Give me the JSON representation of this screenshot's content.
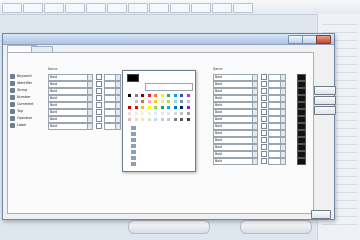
{
  "toolbar": {
    "items": [
      "",
      "",
      "",
      "",
      "",
      "",
      "",
      "",
      "",
      "",
      "",
      ""
    ]
  },
  "dialog": {
    "title": "",
    "tabs": [
      "",
      ""
    ],
    "group_label": "",
    "left_columns": {
      "name": "Name",
      "type": "",
      "back_color": "",
      "fore_color": ""
    },
    "left_rows": [
      {
        "label": "Keyword",
        "style": "Bold",
        "checked": false,
        "color": "#000000"
      },
      {
        "label": "Identifier",
        "style": "Bold",
        "checked": false,
        "color": "#000000"
      },
      {
        "label": "String",
        "style": "Bold",
        "checked": false,
        "color": "#000000"
      },
      {
        "label": "Number",
        "style": "Bold",
        "checked": false,
        "color": "#000000"
      },
      {
        "label": "Comment",
        "style": "Bold",
        "checked": false,
        "color": "#000000"
      },
      {
        "label": "Tag",
        "style": "Bold",
        "checked": false,
        "color": "#000000"
      },
      {
        "label": "Operator",
        "style": "Bold",
        "checked": false,
        "color": "#000000"
      },
      {
        "label": "Label",
        "style": "Bold",
        "checked": false,
        "color": "#000000"
      }
    ],
    "right_columns": {
      "name": "Name",
      "type": "",
      "fore_color": ""
    },
    "right_rows": [
      {
        "style": "Bold",
        "color": "#111111"
      },
      {
        "style": "Bold",
        "color": "#111111"
      },
      {
        "style": "Bold",
        "color": "#111111"
      },
      {
        "style": "Bold",
        "color": "#111111"
      },
      {
        "style": "Bold",
        "color": "#111111"
      },
      {
        "style": "Bold",
        "color": "#111111"
      },
      {
        "style": "Bold",
        "color": "#111111"
      },
      {
        "style": "Bold",
        "color": "#111111"
      },
      {
        "style": "Bold",
        "color": "#111111"
      },
      {
        "style": "Bold",
        "color": "#111111"
      },
      {
        "style": "Bold",
        "color": "#111111"
      },
      {
        "style": "Bold",
        "color": "#111111"
      },
      {
        "style": "Bold",
        "color": "#111111"
      }
    ],
    "buttons": [
      "",
      "",
      ""
    ],
    "popup": {
      "header": "",
      "options": [
        "",
        "",
        "",
        "",
        "",
        "",
        ""
      ]
    }
  },
  "colors": {
    "accent": "#adc4e4",
    "palette": [
      "#000000",
      "#7f7f7f",
      "#880015",
      "#ed1c24",
      "#ff7f27",
      "#fff200",
      "#22b14c",
      "#00a2e8",
      "#3f48cc",
      "#a349a4",
      "#ffffff",
      "#c3c3c3",
      "#b97a57",
      "#ffaec9",
      "#ffc90e",
      "#efe4b0",
      "#b5e61d",
      "#99d9ea",
      "#7092be",
      "#c8bfe7",
      "#c00000",
      "#ff0000",
      "#ffc000",
      "#ffff00",
      "#92d050",
      "#00b050",
      "#00b0f0",
      "#0070c0",
      "#002060",
      "#7030a0",
      "#f2dcdb",
      "#fde9d9",
      "#fff2cc",
      "#ebf1de",
      "#dbeef3",
      "#dce6f1",
      "#e4dfec",
      "#d9d9d9",
      "#bfbfbf",
      "#a5a5a5",
      "#e6b8b7",
      "#fcd5b4",
      "#ffe699",
      "#d8e4bc",
      "#b7dee8",
      "#b8cce4",
      "#ccc0da",
      "#808080",
      "#595959",
      "#404040"
    ]
  }
}
